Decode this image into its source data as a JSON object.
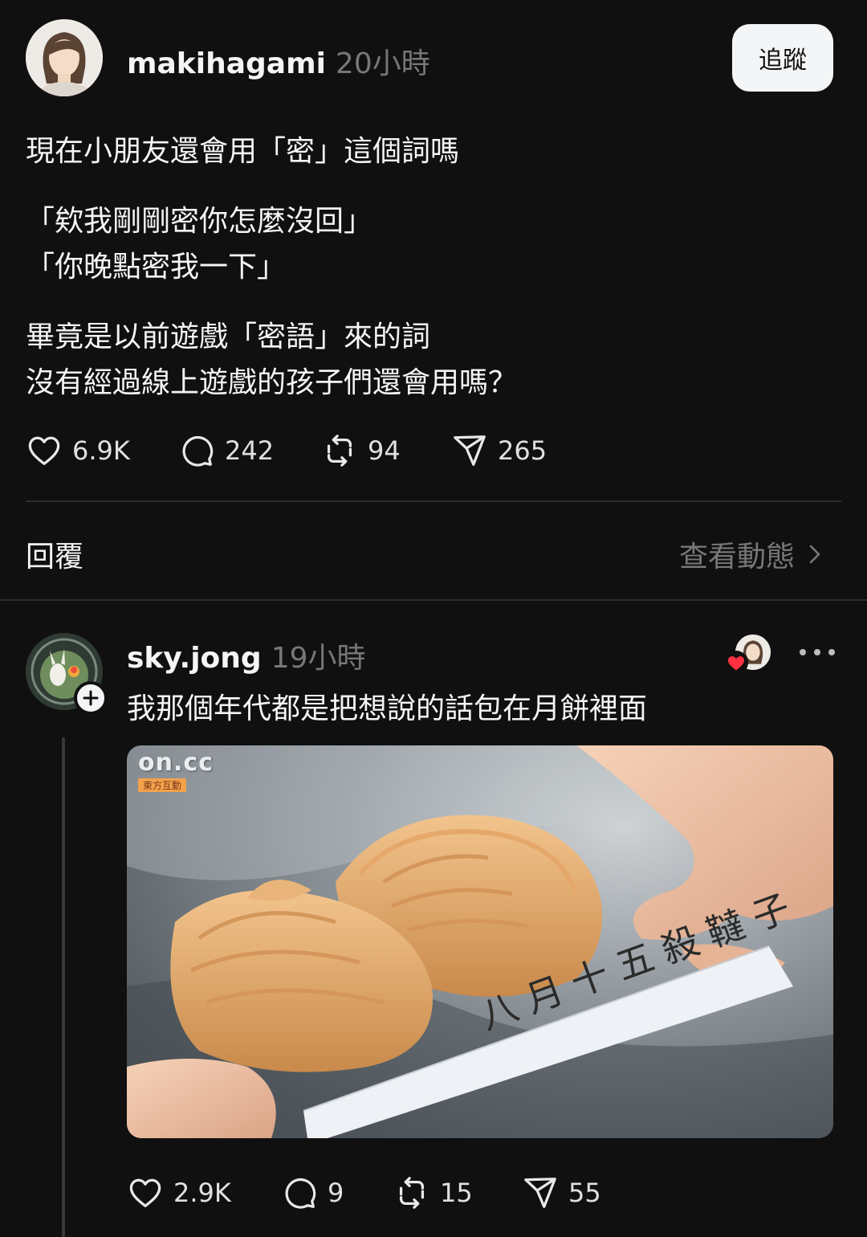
{
  "post": {
    "username": "makihagami",
    "time": "20小時",
    "follow_label": "追蹤",
    "paragraphs": [
      [
        "現在小朋友還會用「密」這個詞嗎"
      ],
      [
        "「欸我剛剛密你怎麼沒回」",
        "「你晚點密我一下」"
      ],
      [
        "畢竟是以前遊戲「密語」來的詞",
        "沒有經過線上遊戲的孩子們還會用嗎？"
      ]
    ],
    "stats": {
      "likes": "6.9K",
      "comments": "242",
      "reposts": "94",
      "shares": "265"
    }
  },
  "replies_bar": {
    "label": "回覆",
    "activity_label": "查看動態"
  },
  "reply": {
    "username": "sky.jong",
    "time": "19小時",
    "text": "我那個年代都是把想說的話包在月餅裡面",
    "image": {
      "watermark_logo": "on.cc",
      "watermark_sub": "東方互動",
      "note_text": "八月十五殺韃子"
    },
    "stats": {
      "likes": "2.9K",
      "comments": "9",
      "reposts": "15",
      "shares": "55"
    }
  },
  "colors": {
    "background": "#101010",
    "text_primary": "#f3f5f7",
    "text_secondary": "#777777",
    "like_heart": "#ff3040"
  },
  "icons": [
    "heart-icon",
    "comment-icon",
    "repost-icon",
    "share-icon",
    "chevron-right-icon",
    "plus-icon",
    "more-icon"
  ]
}
